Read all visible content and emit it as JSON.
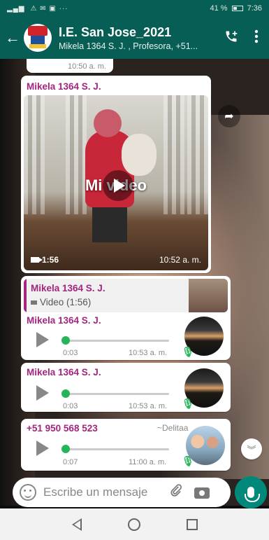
{
  "status_bar": {
    "battery_text": "41 %",
    "clock": "7:36",
    "battery_level": 0.41
  },
  "header": {
    "title": "I.E. San Jose_2021",
    "subtitle": "Mikela 1364 S. J. , Profesora, +51...",
    "back_icon": "arrow-left-icon",
    "call_icon": "add-call-icon",
    "menu_icon": "more-vert-icon"
  },
  "messages": {
    "partial": {
      "time": "10:50 a. m."
    },
    "video": {
      "sender": "Mikela 1364 S. J.",
      "caption": "Mi video",
      "duration": "1:56",
      "time": "10:52 a. m."
    },
    "reply": {
      "quoted_sender": "Mikela 1364 S. J.",
      "quoted_text": "Video (1:56)",
      "sender": "Mikela 1364 S. J.",
      "duration": "0:03",
      "time": "10:53 a. m.",
      "progress": 0.0
    },
    "voice2": {
      "sender": "Mikela 1364 S. J.",
      "duration": "0:03",
      "time": "10:53 a. m.",
      "progress": 0.0
    },
    "voice3": {
      "sender": "+51 950 568 523",
      "pushname": "~Delitaa",
      "duration": "0:07",
      "time": "11:00 a. m.",
      "progress": 0.0
    }
  },
  "composer": {
    "placeholder": "Escribe un mensaje"
  },
  "colors": {
    "header": "#075e54",
    "sender": "#a2257e",
    "accent": "#25b45a",
    "mic": "#00897b"
  }
}
